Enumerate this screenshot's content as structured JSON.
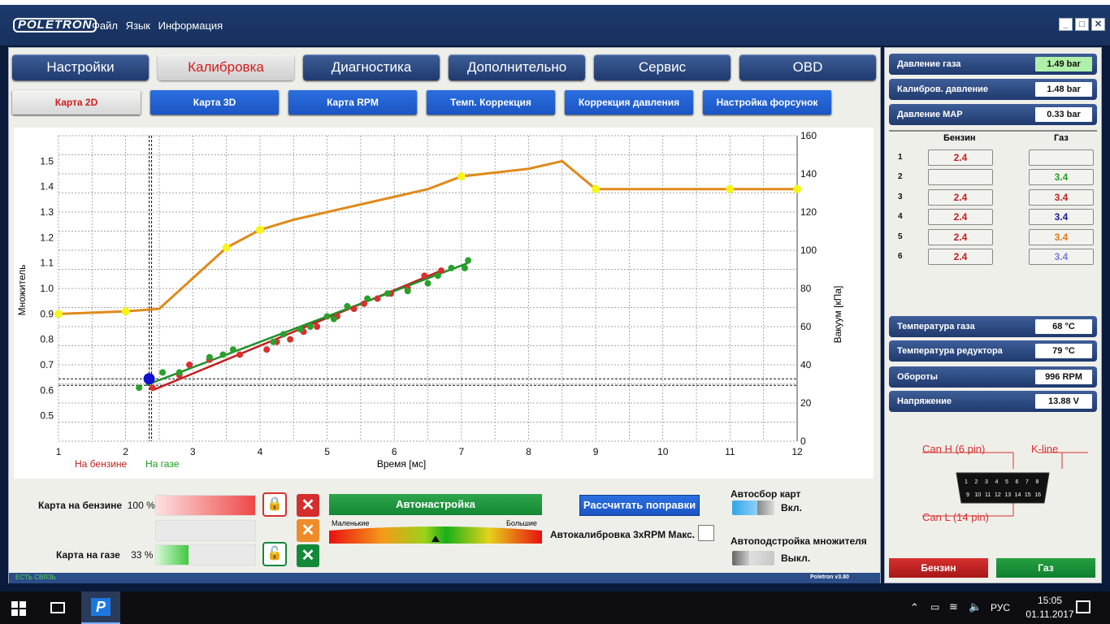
{
  "app": {
    "logo": "POLETRON",
    "menu": [
      "Файл",
      "Язык",
      "Информация"
    ],
    "version": "Poletron v3.80",
    "status": "ЕСТЬ СВЯЗЬ"
  },
  "tabs": [
    {
      "label": "Настройки",
      "active": false
    },
    {
      "label": "Калибровка",
      "active": true
    },
    {
      "label": "Диагностика",
      "active": false
    },
    {
      "label": "Дополнительно",
      "active": false
    },
    {
      "label": "Сервис",
      "active": false
    },
    {
      "label": "OBD",
      "active": false
    }
  ],
  "subtabs": [
    {
      "label": "Карта 2D",
      "active": true
    },
    {
      "label": "Карта 3D",
      "active": false
    },
    {
      "label": "Карта RPM",
      "active": false
    },
    {
      "label": "Темп. Коррекция",
      "active": false
    },
    {
      "label": "Коррекция давления",
      "active": false
    },
    {
      "label": "Настройка форсунок",
      "active": false
    }
  ],
  "chart_data": {
    "type": "scatter",
    "xlabel": "Время [мс]",
    "ylabel_left": "Множитель",
    "ylabel_right": "Вакуум [кПа]",
    "x_ticks": [
      "1",
      "2",
      "3",
      "4",
      "5",
      "6",
      "7",
      "8",
      "9",
      "10",
      "11",
      "12"
    ],
    "y_left_ticks": [
      "0.5",
      "0.6",
      "0.7",
      "0.8",
      "0.9",
      "1.0",
      "1.1",
      "1.2",
      "1.3",
      "1.4",
      "1.5"
    ],
    "y_right_ticks": [
      "0",
      "20",
      "40",
      "60",
      "80",
      "100",
      "120",
      "140",
      "160"
    ],
    "xlim": [
      1,
      12
    ],
    "ylim_left": [
      0.4,
      1.6
    ],
    "ylim_right": [
      0,
      160
    ],
    "legend": [
      {
        "label": "На бензине",
        "color": "#c41e1e"
      },
      {
        "label": "На газе",
        "color": "#16a016"
      }
    ],
    "multiplier_curve": {
      "color": "#e08a1a",
      "line_x": [
        1,
        2,
        2.5,
        3.5,
        4,
        4.5,
        5.5,
        6.5,
        7,
        8,
        8.5,
        9,
        10,
        11,
        12
      ],
      "line_y": [
        0.9,
        0.91,
        0.92,
        1.16,
        1.23,
        1.27,
        1.33,
        1.39,
        1.44,
        1.47,
        1.5,
        1.39,
        1.39,
        1.39,
        1.39
      ],
      "node_x": [
        1,
        2,
        3.5,
        4,
        7,
        9,
        11,
        12
      ],
      "node_y": [
        0.9,
        0.91,
        1.16,
        1.23,
        1.44,
        1.39,
        1.39,
        1.39
      ]
    },
    "petrol_points": {
      "color": "#d83030",
      "x": [
        2.4,
        2.8,
        2.95,
        3.25,
        3.7,
        4.1,
        4.25,
        4.45,
        4.65,
        4.85,
        5.15,
        5.4,
        5.55,
        5.75,
        5.95,
        6.2,
        6.45,
        6.7
      ],
      "y": [
        0.61,
        0.66,
        0.7,
        0.72,
        0.74,
        0.76,
        0.79,
        0.8,
        0.83,
        0.85,
        0.89,
        0.92,
        0.94,
        0.96,
        0.98,
        1.0,
        1.05,
        1.07
      ]
    },
    "petrol_fit": {
      "color": "#c41e1e",
      "x": [
        2.4,
        6.7
      ],
      "y": [
        0.6,
        1.07
      ]
    },
    "gas_points": {
      "color": "#2aa02a",
      "x": [
        2.2,
        2.55,
        2.8,
        3.25,
        3.45,
        3.6,
        4.2,
        4.35,
        4.6,
        4.75,
        5.0,
        5.1,
        5.3,
        5.6,
        5.9,
        6.2,
        6.5,
        6.65,
        6.85,
        7.05,
        7.1
      ],
      "y": [
        0.61,
        0.67,
        0.67,
        0.73,
        0.74,
        0.76,
        0.79,
        0.82,
        0.84,
        0.85,
        0.89,
        0.88,
        0.93,
        0.96,
        0.98,
        0.99,
        1.02,
        1.05,
        1.08,
        1.08,
        1.11
      ]
    },
    "gas_fit": {
      "color": "#1f8f2a",
      "x": [
        2.3,
        7.1
      ],
      "y": [
        0.62,
        1.1
      ]
    },
    "cursor": {
      "x": 2.35,
      "y": 0.645,
      "color": "#1010d0"
    },
    "grid": true
  },
  "controls": {
    "map_petrol_label": "Карта на бензине",
    "map_petrol_pct": "100 %",
    "map_petrol_value": 1.0,
    "map_gas_label": "Карта на газе",
    "map_gas_pct": "33 %",
    "map_gas_value": 0.33,
    "autotune_label": "Автонастройка",
    "scale_small": "Маленькие",
    "scale_big": "Большие",
    "calc_label": "Рассчитать поправки",
    "autocalib_label": "Автокалибровка 3xRPM Макс.",
    "autocollect_label": "Автосбор карт",
    "autocollect_state": "Вкл.",
    "autotune_mult_label": "Автоподстройка  множителя",
    "autotune_mult_state": "Выкл."
  },
  "right": {
    "rows_top": [
      {
        "label": "Давление газа",
        "value": "1.49 bar",
        "highlight": "#aef0a8"
      },
      {
        "label": "Калибров. давление",
        "value": "1.48 bar",
        "highlight": "#ffffff"
      },
      {
        "label": "Давление MAP",
        "value": "0.33 bar",
        "highlight": "#ffffff"
      }
    ],
    "inj_header_petrol": "Бензин",
    "inj_header_gas": "Газ",
    "injectors": [
      {
        "n": "1",
        "petrol": "2.4",
        "gas": "",
        "gas_color": "#222"
      },
      {
        "n": "2",
        "petrol": "",
        "gas": "3.4",
        "gas_color": "#26a026"
      },
      {
        "n": "3",
        "petrol": "2.4",
        "gas": "3.4",
        "gas_color": "#c41e1e"
      },
      {
        "n": "4",
        "petrol": "2.4",
        "gas": "3.4",
        "gas_color": "#1a1a9a"
      },
      {
        "n": "5",
        "petrol": "2.4",
        "gas": "3.4",
        "gas_color": "#e07a1a"
      },
      {
        "n": "6",
        "petrol": "2.4",
        "gas": "3.4",
        "gas_color": "#7a7ad8"
      }
    ],
    "rows_bottom": [
      {
        "label": "Температура газа",
        "value": "68 °C"
      },
      {
        "label": "Температура редуктора",
        "value": "79 °C"
      },
      {
        "label": "Обороты",
        "value": "996 RPM"
      },
      {
        "label": "Напряжение",
        "value": "13.88 V"
      }
    ],
    "obd": {
      "can_h": "Can H (6 pin)",
      "kline": "K-line",
      "can_l": "Can L (14 pin)",
      "pins_top": [
        "1",
        "2",
        "3",
        "4",
        "5",
        "6",
        "7",
        "8"
      ],
      "pins_bottom": [
        "9",
        "10",
        "11",
        "12",
        "13",
        "14",
        "15",
        "16"
      ]
    },
    "btn_petrol": "Бензин",
    "btn_gas": "Газ"
  },
  "taskbar": {
    "lang": "РУС",
    "time": "15:05",
    "date": "01.11.2017",
    "app_icon": "P"
  }
}
